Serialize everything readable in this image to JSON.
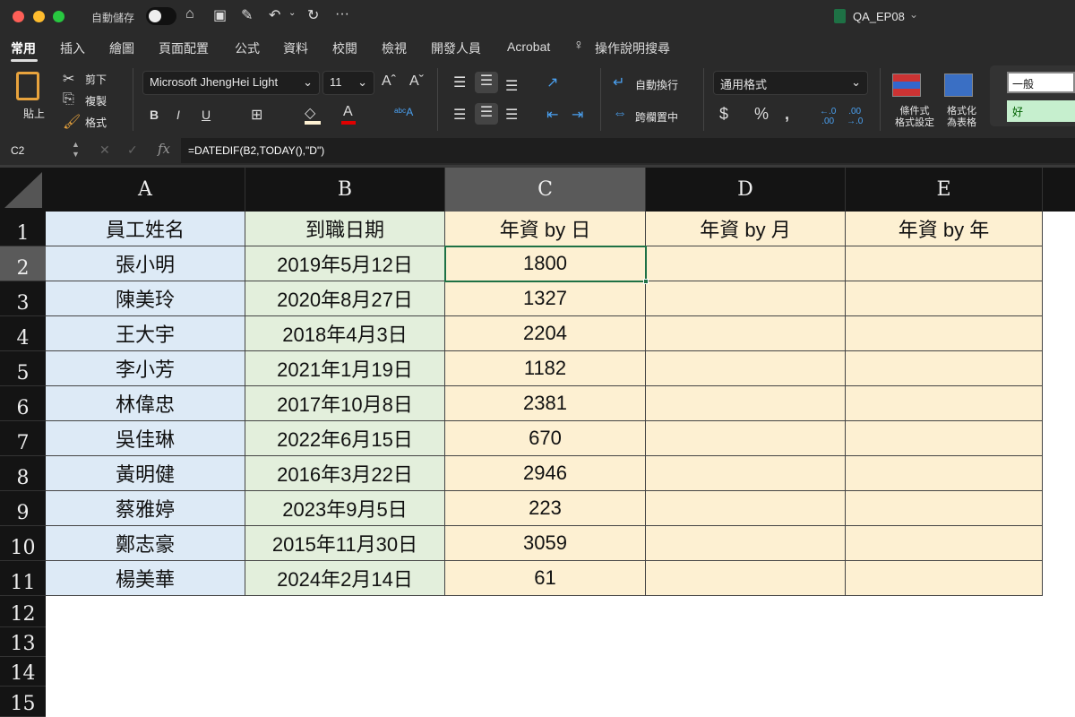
{
  "titlebar": {
    "autosave_label": "自動儲存",
    "file_name": "QA_EP08"
  },
  "tabs": [
    "常用",
    "插入",
    "繪圖",
    "頁面配置",
    "公式",
    "資料",
    "校閱",
    "檢視",
    "開發人員",
    "Acrobat"
  ],
  "help_search": "操作說明搜尋",
  "ribbon": {
    "paste": "貼上",
    "cut": "剪下",
    "copy": "複製",
    "format_painter": "格式",
    "font_name": "Microsoft JhengHei Light",
    "font_size": "11",
    "wrap_text": "自動換行",
    "merge_center": "跨欄置中",
    "number_format": "通用格式",
    "conditional_format": [
      "條件式",
      "格式設定"
    ],
    "format_as_table": [
      "格式化",
      "為表格"
    ],
    "style_normal": "一般",
    "style_good": "好",
    "colors": {
      "fill_swatch": "#fdf0d2",
      "font_swatch": "#e00000"
    }
  },
  "formula_bar": {
    "name_box": "C2",
    "formula": "=DATEDIF(B2,TODAY(),\"D\")"
  },
  "sheet": {
    "columns": [
      "A",
      "B",
      "C",
      "D",
      "E"
    ],
    "row_numbers": [
      "1",
      "2",
      "3",
      "4",
      "5",
      "6",
      "7",
      "8",
      "9",
      "10",
      "11",
      "12",
      "13",
      "14",
      "15"
    ],
    "headers": [
      "員工姓名",
      "到職日期",
      "年資 by 日",
      "年資 by 月",
      "年資 by 年"
    ],
    "rows": [
      [
        "張小明",
        "2019年5月12日",
        "1800"
      ],
      [
        "陳美玲",
        "2020年8月27日",
        "1327"
      ],
      [
        "王大宇",
        "2018年4月3日",
        "2204"
      ],
      [
        "李小芳",
        "2021年1月19日",
        "1182"
      ],
      [
        "林偉忠",
        "2017年10月8日",
        "2381"
      ],
      [
        "吳佳琳",
        "2022年6月15日",
        "670"
      ],
      [
        "黃明健",
        "2016年3月22日",
        "2946"
      ],
      [
        "蔡雅婷",
        "2023年9月5日",
        "223"
      ],
      [
        "鄭志豪",
        "2015年11月30日",
        "3059"
      ],
      [
        "楊美華",
        "2024年2月14日",
        "61"
      ]
    ],
    "selected_cell": "C2"
  }
}
